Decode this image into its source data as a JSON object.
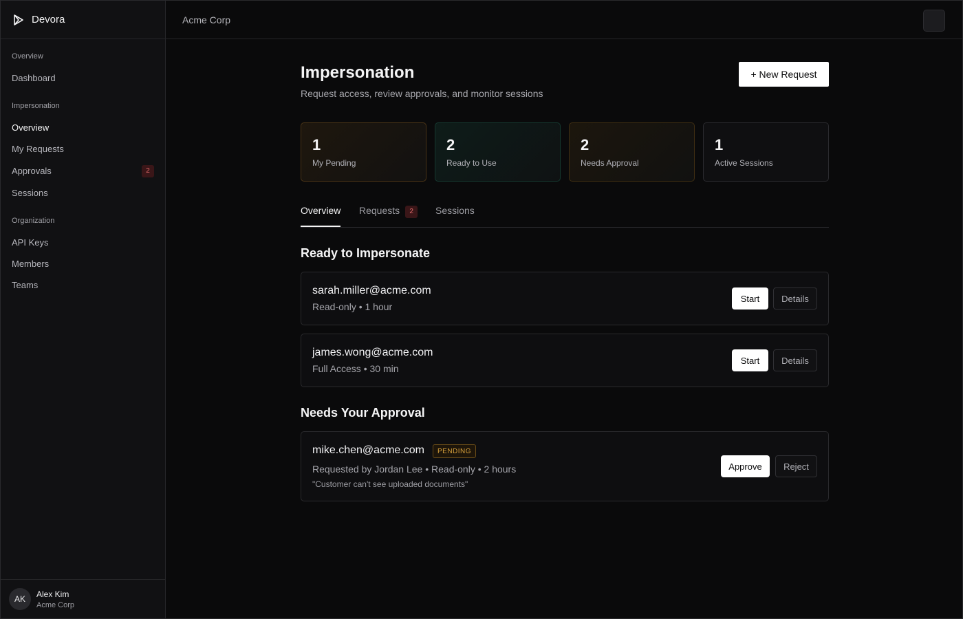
{
  "brand": {
    "name": "Devora"
  },
  "sidebar": {
    "sections": [
      {
        "heading": "Overview",
        "items": [
          {
            "label": "Dashboard"
          }
        ]
      },
      {
        "heading": "Impersonation",
        "items": [
          {
            "label": "Overview",
            "active": true
          },
          {
            "label": "My Requests"
          },
          {
            "label": "Approvals",
            "badge": "2"
          },
          {
            "label": "Sessions"
          }
        ]
      },
      {
        "heading": "Organization",
        "items": [
          {
            "label": "API Keys"
          },
          {
            "label": "Members"
          },
          {
            "label": "Teams"
          }
        ]
      }
    ],
    "user": {
      "initials": "AK",
      "name": "Alex Kim",
      "org": "Acme Corp"
    }
  },
  "topbar": {
    "org": "Acme Corp"
  },
  "page": {
    "title": "Impersonation",
    "subtitle": "Request access, review approvals, and monitor sessions",
    "new_button": "+ New Request"
  },
  "stats": [
    {
      "value": "1",
      "label": "My Pending"
    },
    {
      "value": "2",
      "label": "Ready to Use"
    },
    {
      "value": "2",
      "label": "Needs Approval"
    },
    {
      "value": "1",
      "label": "Active Sessions"
    }
  ],
  "tabs": [
    {
      "label": "Overview",
      "active": true
    },
    {
      "label": "Requests",
      "badge": "2"
    },
    {
      "label": "Sessions"
    }
  ],
  "ready": {
    "title": "Ready to Impersonate",
    "items": [
      {
        "email": "sarah.miller@acme.com",
        "meta": "Read-only • 1 hour",
        "start": "Start",
        "details": "Details"
      },
      {
        "email": "james.wong@acme.com",
        "meta": "Full Access • 30 min",
        "start": "Start",
        "details": "Details"
      }
    ]
  },
  "approval": {
    "title": "Needs Your Approval",
    "items": [
      {
        "email": "mike.chen@acme.com",
        "status": "PENDING",
        "meta": "Requested by Jordan Lee • Read-only • 2 hours",
        "note": "\"Customer can't see uploaded documents\"",
        "approve": "Approve",
        "reject": "Reject"
      }
    ]
  },
  "colors": {
    "accent": "#ffffff",
    "background": "#0a0a0b",
    "badge_red": "#e06a6a",
    "pending": "#d6a03c"
  }
}
